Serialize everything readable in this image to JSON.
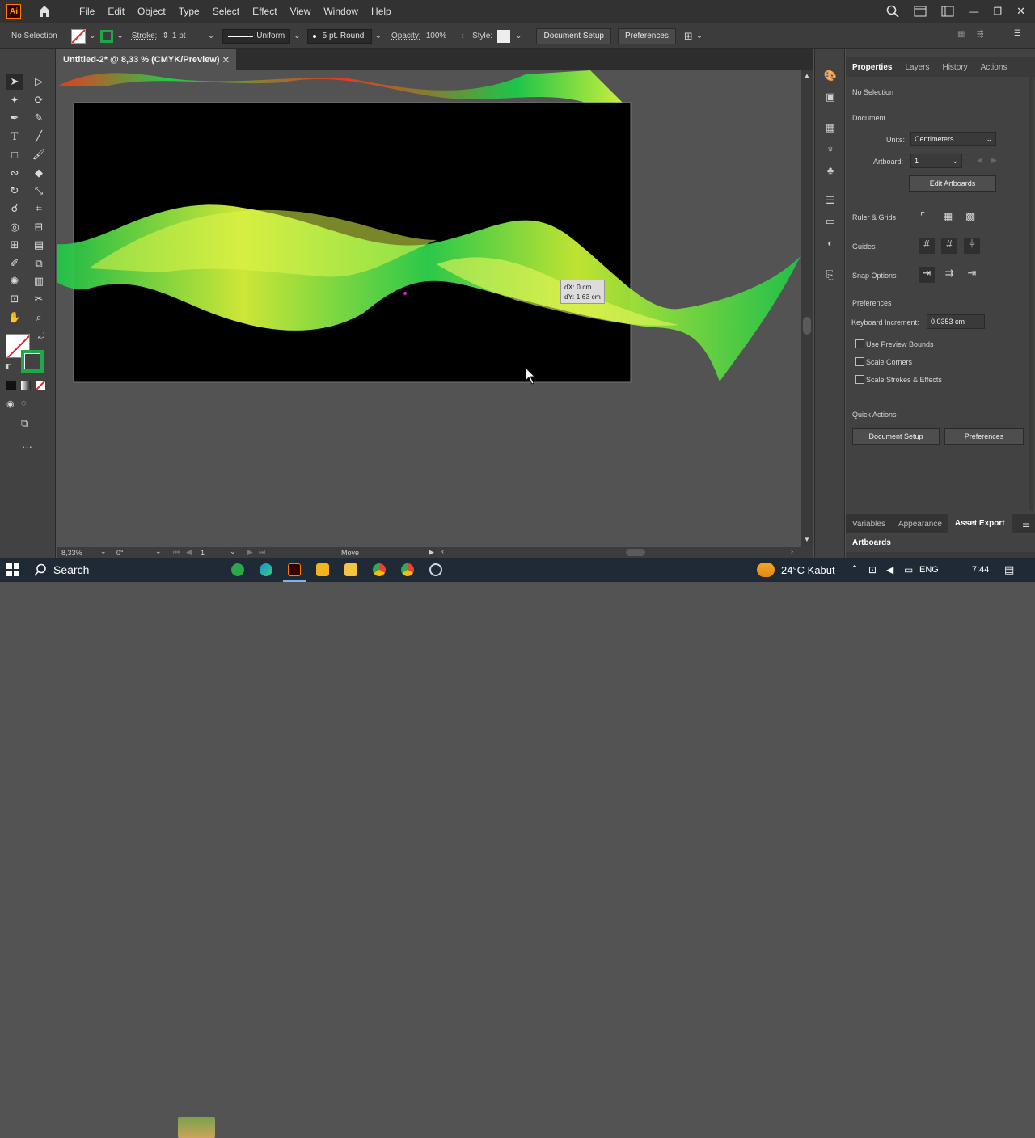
{
  "menubar": {
    "app_logo": "Ai",
    "menus": [
      "File",
      "Edit",
      "Object",
      "Type",
      "Select",
      "Effect",
      "View",
      "Window",
      "Help"
    ]
  },
  "controlbar": {
    "selection": "No Selection",
    "stroke_label": "Stroke:",
    "stroke_value": "1 pt",
    "profile": "Uniform",
    "brush": "5 pt. Round",
    "opacity_label": "Opacity:",
    "opacity_value": "100%",
    "style_label": "Style:",
    "document_setup": "Document Setup",
    "preferences": "Preferences"
  },
  "document": {
    "tab_title": "Untitled-2* @ 8,33 % (CMYK/Preview)",
    "close": "✕"
  },
  "canvas": {
    "tooltip_dx": "dX: 0 cm",
    "tooltip_dy": "dY: 1,63 cm",
    "colors": {
      "artboard": "#000000",
      "green": "#1ec44a",
      "yellow": "#d8f23a",
      "red": "#e53a1e"
    }
  },
  "properties": {
    "tabs": [
      "Properties",
      "Layers",
      "History",
      "Actions"
    ],
    "no_selection": "No Selection",
    "document_heading": "Document",
    "units_label": "Units:",
    "units_value": "Centimeters",
    "artboard_label": "Artboard:",
    "artboard_value": "1",
    "edit_artboards": "Edit Artboards",
    "ruler_grids": "Ruler & Grids",
    "guides": "Guides",
    "snap_options": "Snap Options",
    "preferences_heading": "Preferences",
    "keyboard_increment_label": "Keyboard Increment:",
    "keyboard_increment_value": "0,0353 cm",
    "use_preview_bounds": "Use Preview Bounds",
    "scale_corners": "Scale Corners",
    "scale_strokes": "Scale Strokes & Effects",
    "quick_actions": "Quick Actions",
    "qa_document_setup": "Document Setup",
    "qa_preferences": "Preferences"
  },
  "bottom_panel": {
    "tabs": [
      "Variables",
      "Appearance",
      "Asset Export"
    ],
    "artboards": "Artboards"
  },
  "statusbar": {
    "zoom": "8,33%",
    "rotation": "0°",
    "artboard_nav": "1",
    "tool": "Move"
  },
  "taskbar": {
    "search": "Search",
    "weather": "24°C Kabut",
    "language": "ENG",
    "time": "7:44"
  }
}
